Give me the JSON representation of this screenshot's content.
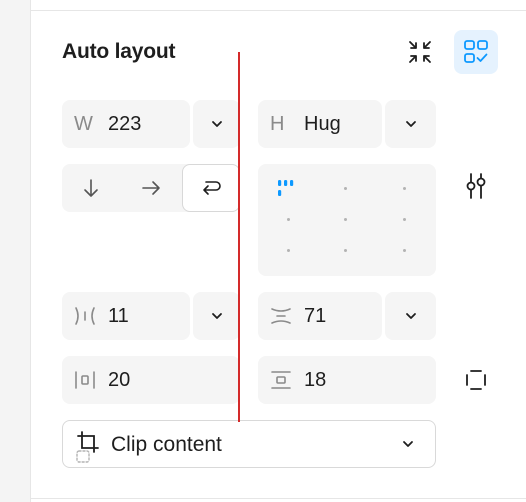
{
  "section": {
    "title": "Auto layout"
  },
  "width": {
    "label": "W",
    "value": "223"
  },
  "height": {
    "label": "H",
    "value": "Hug"
  },
  "direction": {
    "options": [
      "vertical",
      "horizontal",
      "wrap"
    ],
    "selected": "wrap"
  },
  "gap_horizontal": {
    "value": "11"
  },
  "gap_vertical": {
    "value": "71"
  },
  "padding_horizontal": {
    "value": "20"
  },
  "padding_vertical": {
    "value": "18"
  },
  "clip": {
    "label": "Clip content"
  },
  "colors": {
    "accent": "#0d99ff",
    "active_bg": "#e5f2fe",
    "field_bg": "#f5f5f5",
    "marker_line": "#d42a2a"
  },
  "icons": [
    "collapse-icon",
    "auto-layout-suggestion-icon",
    "chevron-down-icon",
    "arrow-down-icon",
    "arrow-right-icon",
    "wrap-icon",
    "sliders-icon",
    "horizontal-gap-icon",
    "vertical-gap-icon",
    "horizontal-padding-icon",
    "vertical-padding-icon",
    "individual-padding-icon",
    "crop-icon"
  ]
}
